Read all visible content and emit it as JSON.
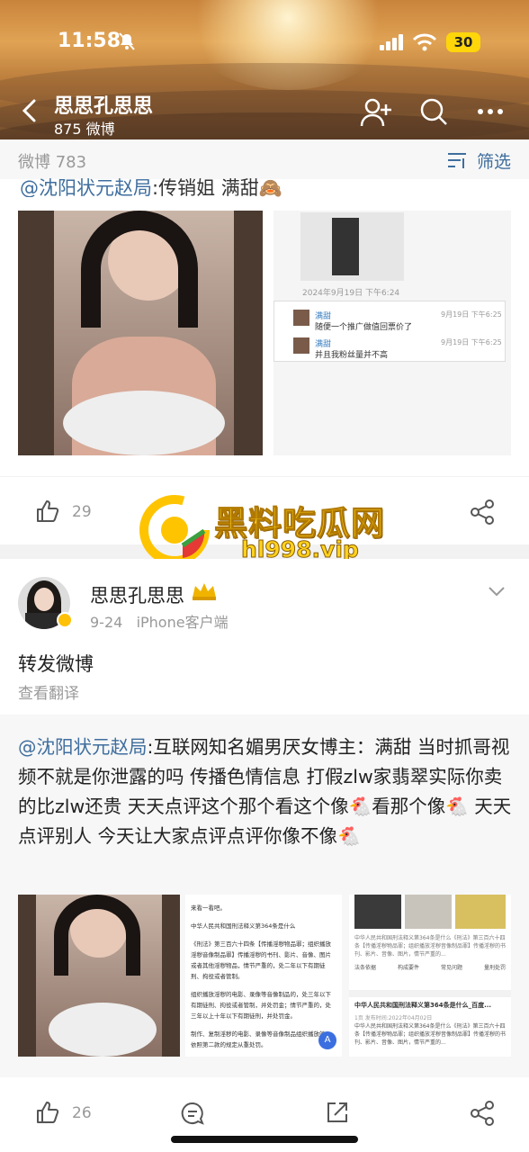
{
  "status_bar": {
    "time": "11:58",
    "battery": "30"
  },
  "header": {
    "title": "思思孔思思",
    "subtitle": "875 微博"
  },
  "filter_bar": {
    "count_label": "微博 783",
    "filter_label": "筛选"
  },
  "post1": {
    "repost_text_prefix": "@沈阳状元赵局",
    "repost_text_rest": ":传销姐 满甜",
    "chat_date": "2024年9月19日 下午6:24",
    "chat_msgs": [
      {
        "name": "满甜",
        "time": "9月19日 下午6:25",
        "text": "随便一个推广做值回票价了"
      },
      {
        "name": "满甜",
        "time": "9月19日 下午6:25",
        "text": "并且我粉丝量并不高"
      }
    ],
    "like_count": "29"
  },
  "watermark": {
    "title": "黑料吃瓜网",
    "url": "hl998.vip"
  },
  "post2": {
    "author": "思思孔思思",
    "meta": "9-24   iPhone客户端",
    "body": "转发微博",
    "translate": "查看翻译",
    "repost_mention": "@沈阳状元赵局",
    "repost_body": ":互联网知名媚男厌女博主：满甜  当时抓哥视频不就是你泄露的吗 传播色情信息 打假zlw家翡翠实际你卖的比zlw还贵 天天点评这个那个看这个像🐔看那个像🐔  天天点评别人 今天让大家点评点评你像不像🐔",
    "doc_lines": [
      "来看一看吧。",
      "中华人民共和国刑法释义第364条是什么",
      "《刑法》第三百六十四条【传播淫秽物品罪；组织播放淫秽音像制品罪】传播淫秽的书刊、影片、音像、图片或者其他淫秽物品，情节严重的，处二年以下有期徒刑、拘役或者管制。",
      "组织播放淫秽的电影、录像等音像制品的，处三年以下有期徒刑、拘役或者管制，并处罚金；情节严重的，处三年以上十年以下有期徒刑，并处罚金。",
      "制作、复制淫秽的电影、录像等音像制品组织播放的，依照第二款的规定从重处罚。"
    ],
    "search_tabs": [
      "法条依据",
      "构成要件",
      "常见问题",
      "量刑处罚"
    ],
    "search_title": "中华人民共和国刑法释义第364条是什么_百度...",
    "search_date": "1页 发布时间:2022年04月02日",
    "search_snippet": "中华人民共和国刑法释义第364条是什么《刑法》第三百六十四条【传播淫秽物品罪；组织播放淫秽音像制品罪】传播淫秽的书刊、影片、音像、图片，情节严重的...",
    "like_count": "26"
  },
  "colors": {
    "accent": "#ff8200",
    "link": "#3f6e9e"
  }
}
